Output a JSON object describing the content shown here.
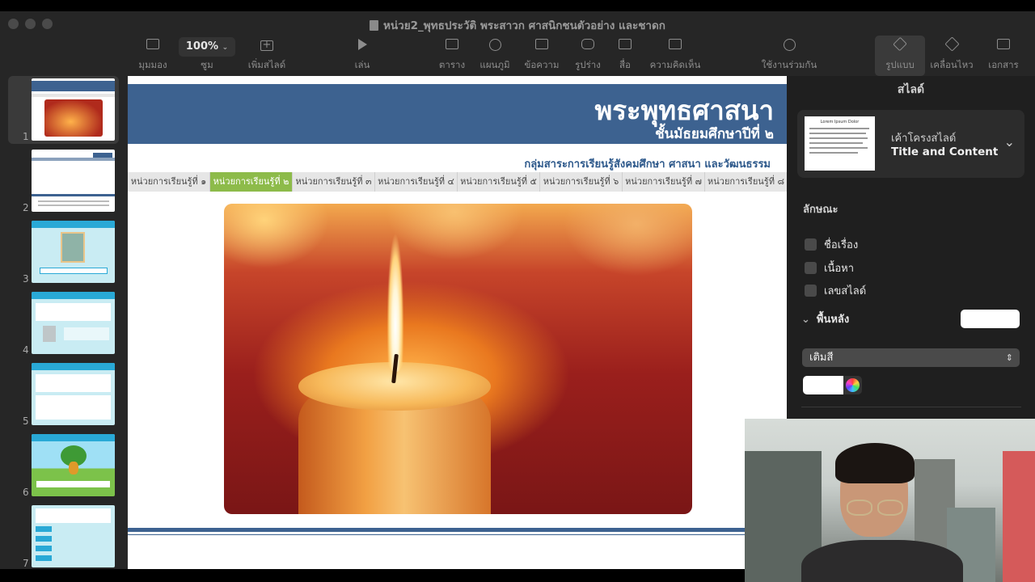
{
  "window": {
    "title": "หน่วย2_พุทธประวัติ พระสาวก ศาสนิกชนตัวอย่าง และชาดก"
  },
  "toolbar": {
    "view_label": "มุมมอง",
    "zoom_value": "100%",
    "zoom_label": "ซูม",
    "add_slide_label": "เพิ่มสไลด์",
    "play_label": "เล่น",
    "table_label": "ตาราง",
    "chart_label": "แผนภูมิ",
    "text_label": "ข้อความ",
    "shape_label": "รูปร่าง",
    "media_label": "สื่อ",
    "comment_label": "ความคิดเห็น",
    "collaborate_label": "ใช้งานร่วมกัน",
    "format_label": "รูปแบบ",
    "animate_label": "เคลื่อนไหว",
    "document_label": "เอกสาร"
  },
  "sidebar": {
    "slides": [
      {
        "number": "1"
      },
      {
        "number": "2"
      },
      {
        "number": "3"
      },
      {
        "number": "4"
      },
      {
        "number": "5"
      },
      {
        "number": "6"
      },
      {
        "number": "7"
      }
    ]
  },
  "slide": {
    "title": "พระพุทธศาสนา",
    "subtitle": "ชั้นมัธยมศึกษาปีที่ ๒",
    "subject": "กลุ่มสาระการเรียนรู้สังคมศึกษา ศาสนา และวัฒนธรรม",
    "nav_tabs": [
      {
        "label": "หน่วยการเรียนรู้ที่ ๑"
      },
      {
        "label": "หน่วยการเรียนรู้ที่ ๒"
      },
      {
        "label": "หน่วยการเรียนรู้ที่ ๓"
      },
      {
        "label": "หน่วยการเรียนรู้ที่ ๔"
      },
      {
        "label": "หน่วยการเรียนรู้ที่ ๕"
      },
      {
        "label": "หน่วยการเรียนรู้ที่ ๖"
      },
      {
        "label": "หน่วยการเรียนรู้ที่ ๗"
      },
      {
        "label": "หน่วยการเรียนรู้ที่ ๘"
      }
    ],
    "active_tab": "หน่วยการเรียนรู้ที่ ๒"
  },
  "panel": {
    "title": "สไลด์",
    "layout_label": "เค้าโครงสไลด์",
    "layout_name": "Title and Content",
    "layout_thumb_title": "Lorem Ipsum Dolor",
    "appearance_heading": "ลักษณะ",
    "checkbox_title": "ชื่อเรื่อง",
    "checkbox_body": "เนื้อหา",
    "checkbox_slide_number": "เลขสไลด์",
    "background_heading": "พื้นหลัง",
    "fill_value": "เติมสี"
  },
  "colors": {
    "header_blue": "#3d6290",
    "active_tab_green": "#8dbb4a"
  }
}
